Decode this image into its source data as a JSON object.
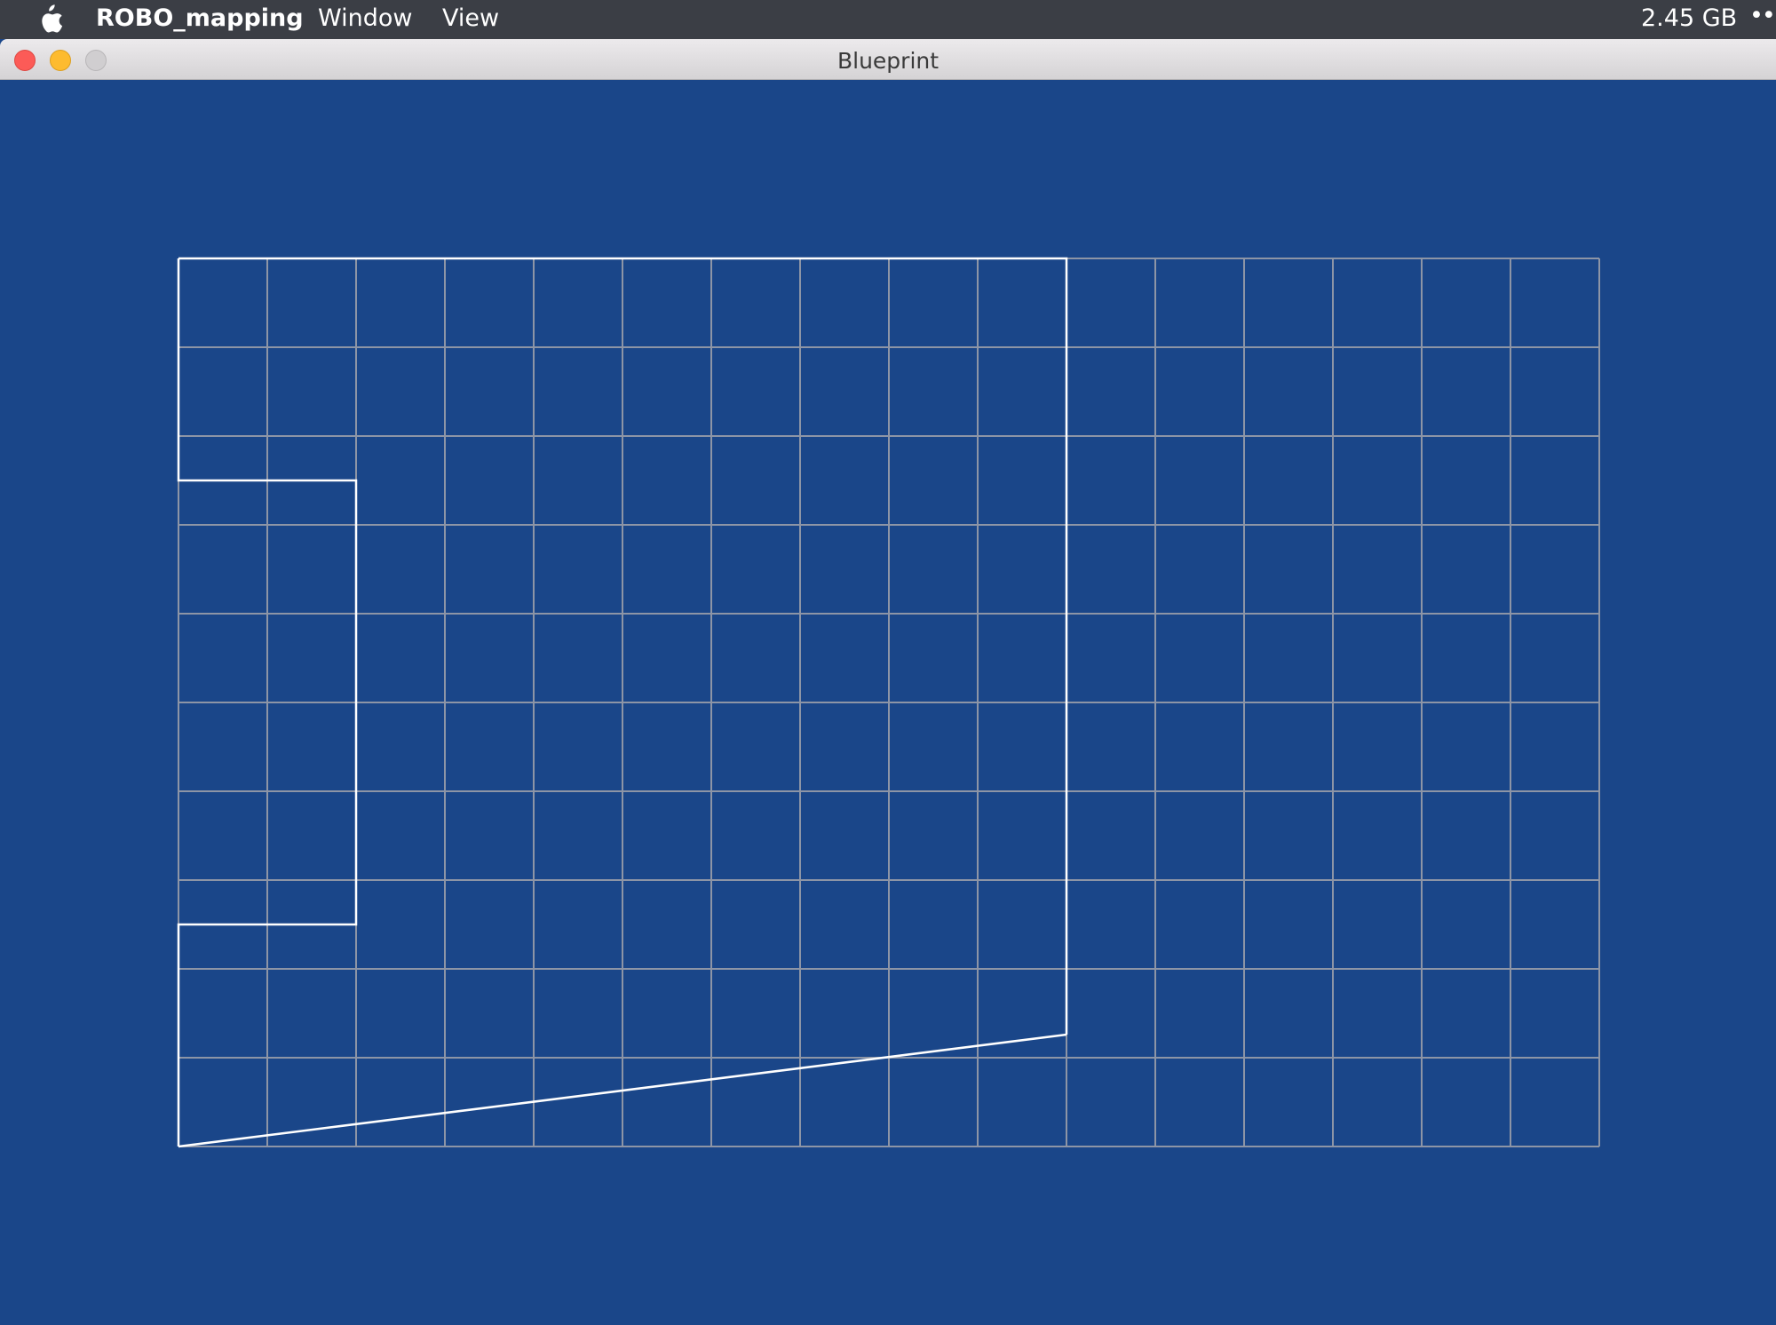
{
  "menubar": {
    "apple_icon": "apple-logo-icon",
    "app_name": "ROBO_mapping",
    "menus": [
      "Window",
      "View"
    ],
    "memory": "2.45 GB",
    "more": "•••"
  },
  "window": {
    "title": "Blueprint",
    "controls": [
      "close",
      "minimize",
      "zoom"
    ]
  },
  "blueprint": {
    "grid_columns": 16,
    "grid_rows": 10,
    "background_color": "#1a4689",
    "grid_color": "#8d95a6",
    "wall_color": "#ffffff"
  }
}
